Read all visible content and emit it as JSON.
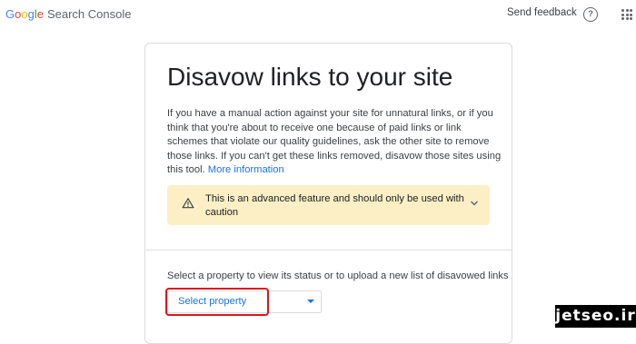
{
  "header": {
    "logo_google": "Google",
    "logo_product": "Search Console",
    "send_feedback": "Send feedback",
    "help_icon": "help-icon",
    "apps_icon": "apps-grid-icon"
  },
  "card": {
    "title": "Disavow links to your site",
    "description": "If you have a manual action against your site for unnatural links, or if you think that you're about to receive one because of paid links or link schemes that violate our quality guidelines, ask the other site to remove those links. If you can't get these links removed, disavow those sites using this tool.",
    "more_info_link": "More information",
    "warning": {
      "icon": "warning-triangle-icon",
      "text": "This is an advanced feature and should only be used with caution",
      "toggle_icon": "chevron-down-icon"
    },
    "property_prompt": "Select a property to view its status or to upload a new list of disavowed links",
    "property_select": {
      "label": "Select property",
      "caret_icon": "dropdown-caret-icon"
    }
  },
  "watermark": "jetseo.ir",
  "colors": {
    "link_blue": "#1a73e8",
    "warning_bg": "#fcefc5",
    "highlight_red": "#d9151b"
  }
}
